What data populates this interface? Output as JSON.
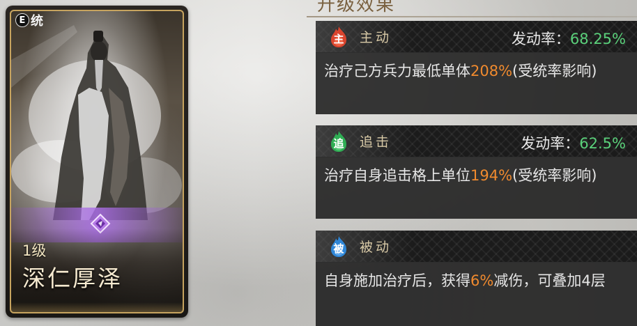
{
  "section_title": "升级效果",
  "card": {
    "badge_icon": "统",
    "badge_mark": "E",
    "level": "1级",
    "name": "深仁厚泽",
    "gem_color": "#b57ae6",
    "frame_color": "#c7a45f"
  },
  "skills": [
    {
      "icon_char": "主",
      "icon_color": "#d9452e",
      "type": "主动",
      "rate_label": "发动率：",
      "rate_value": "68.25%",
      "desc_pre": "治疗己方兵力最低单体",
      "desc_hl": "208%",
      "desc_post": "(受统率影响)"
    },
    {
      "icon_char": "追",
      "icon_color": "#2fae54",
      "type": "追击",
      "rate_label": "发动率：",
      "rate_value": "62.5%",
      "desc_pre": "治疗自身追击格上单位",
      "desc_hl": "194%",
      "desc_post": "(受统率影响)"
    },
    {
      "icon_char": "被",
      "icon_color": "#2f86d6",
      "type": "被动",
      "desc_pre": "自身施加治疗后，获得",
      "desc_hl": "6%",
      "desc_post": "减伤，可叠加4层"
    }
  ],
  "colors": {
    "highlight": "#f08a2e",
    "rate_value": "#5ad07a"
  }
}
